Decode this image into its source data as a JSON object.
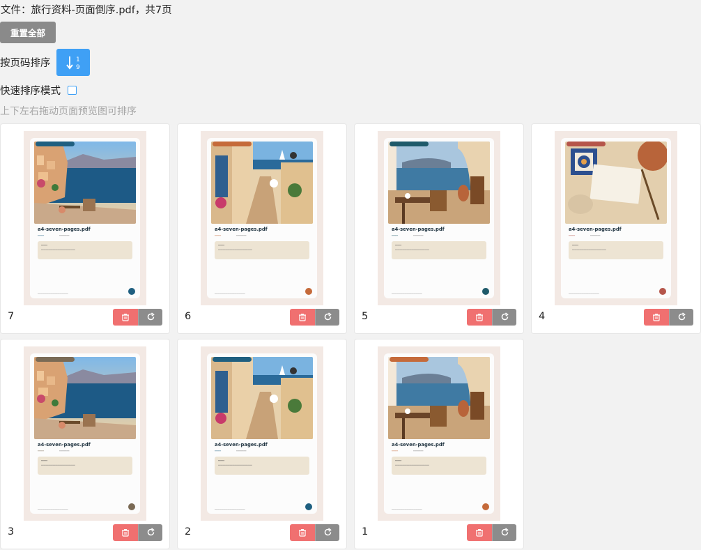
{
  "header": {
    "file_title": "文件：旅行资料-页面倒序.pdf，共7页",
    "reset_label": "重置全部",
    "sort_label": "按页码排序",
    "sort_icon": "sort-ascending-1-9-icon",
    "fast_mode_label": "快速排序模式",
    "fast_mode_checked": false,
    "hint": "上下左右拖动页面预览图可排序"
  },
  "colors": {
    "accent": "#3fa0f5",
    "delete": "#f07070",
    "rotate": "#8c8c8c",
    "reset": "#8a8a8a"
  },
  "pages": [
    {
      "number": "7",
      "scene": "amalfi",
      "accent": "#1f5f80",
      "doc_name": "a4-seven-pages.pdf"
    },
    {
      "number": "6",
      "scene": "alley",
      "accent": "#c56a3a",
      "doc_name": "a4-seven-pages.pdf"
    },
    {
      "number": "5",
      "scene": "terrace",
      "accent": "#1f5a6a",
      "doc_name": "a4-seven-pages.pdf"
    },
    {
      "number": "4",
      "scene": "tile",
      "accent": "#b5554a",
      "doc_name": "a4-seven-pages.pdf"
    },
    {
      "number": "3",
      "scene": "amalfi",
      "accent": "#7a6a55",
      "doc_name": "a4-seven-pages.pdf"
    },
    {
      "number": "2",
      "scene": "alley",
      "accent": "#1f5f80",
      "doc_name": "a4-seven-pages.pdf"
    },
    {
      "number": "1",
      "scene": "terrace",
      "accent": "#c56a3a",
      "doc_name": "a4-seven-pages.pdf"
    }
  ],
  "icons": {
    "delete": "trash-icon",
    "rotate": "rotate-clockwise-icon"
  }
}
